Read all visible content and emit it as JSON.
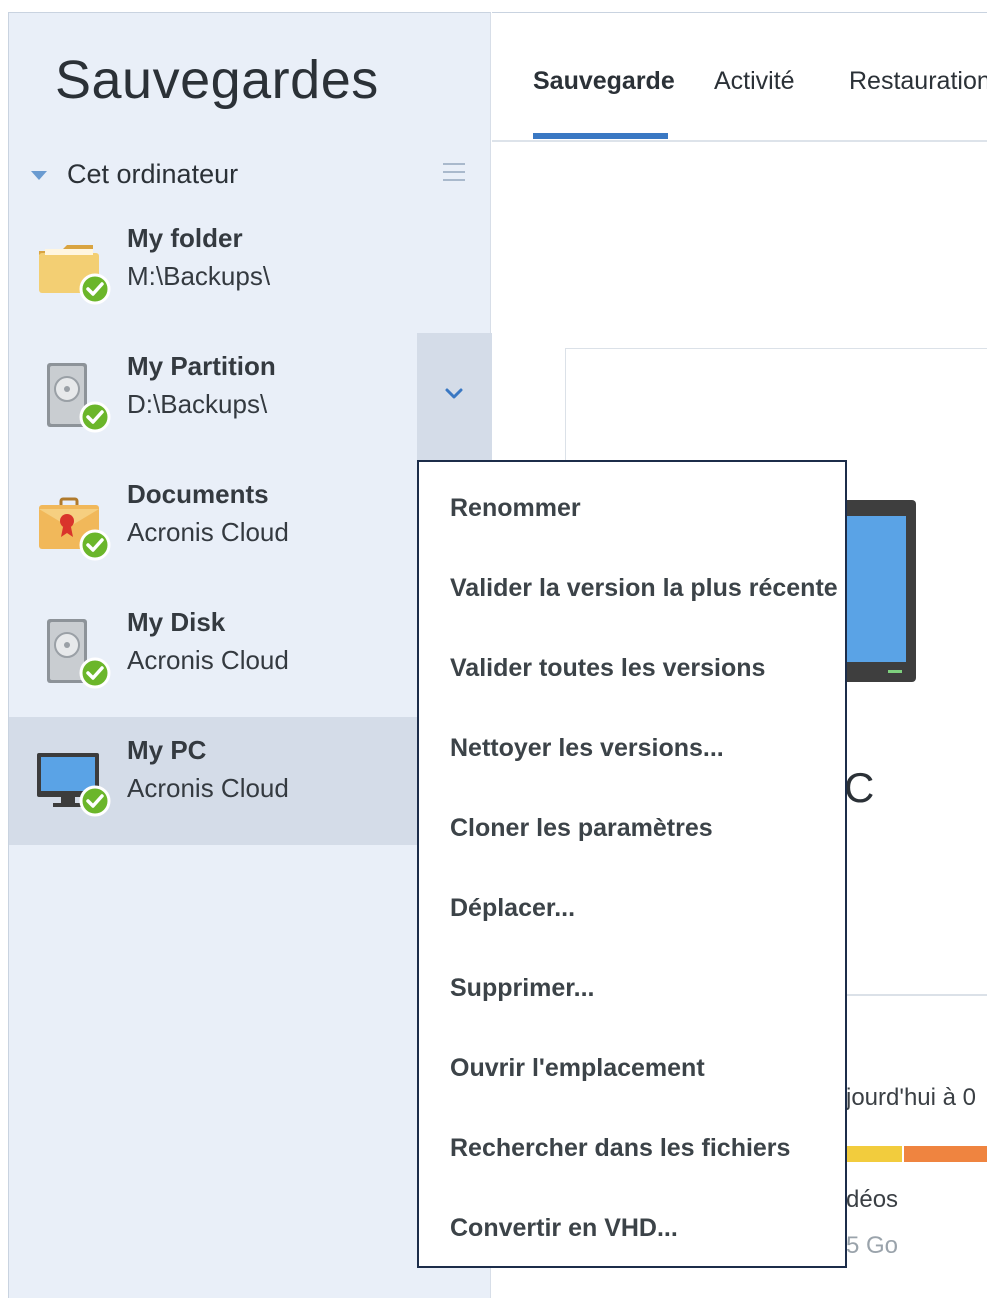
{
  "sidebar": {
    "title": "Sauvegardes",
    "section_label": "Cet ordinateur",
    "items": [
      {
        "name": "My folder",
        "location": "M:\\Backups\\",
        "icon": "folder-icon"
      },
      {
        "name": "My Partition",
        "location": "D:\\Backups\\",
        "icon": "hard-drive-icon"
      },
      {
        "name": "Documents",
        "location": "Acronis Cloud",
        "icon": "briefcase-icon"
      },
      {
        "name": "My Disk",
        "location": "Acronis Cloud",
        "icon": "hard-drive-icon"
      },
      {
        "name": "My PC",
        "location": "Acronis Cloud",
        "icon": "monitor-icon"
      }
    ]
  },
  "tabs": [
    {
      "label": "Sauvegarde"
    },
    {
      "label": "Activité"
    },
    {
      "label": "Restauration"
    }
  ],
  "context_menu": {
    "items": [
      "Renommer",
      "Valider la version la plus récente",
      "Valider toutes les versions",
      "Nettoyer les versions...",
      "Cloner les paramètres",
      "Déplacer...",
      "Supprimer...",
      "Ouvrir l'emplacement",
      "Rechercher dans les fichiers",
      "Convertir en VHD..."
    ]
  },
  "main": {
    "source_name_partial": "C",
    "last_backup_partial": "jourd'hui à 0",
    "legend_partial": "déos",
    "size_partial": "5 Go"
  },
  "colors": {
    "sidebar_bg": "#e9eff8",
    "accent": "#3a78c3",
    "status_ok": "#6bb62a"
  }
}
